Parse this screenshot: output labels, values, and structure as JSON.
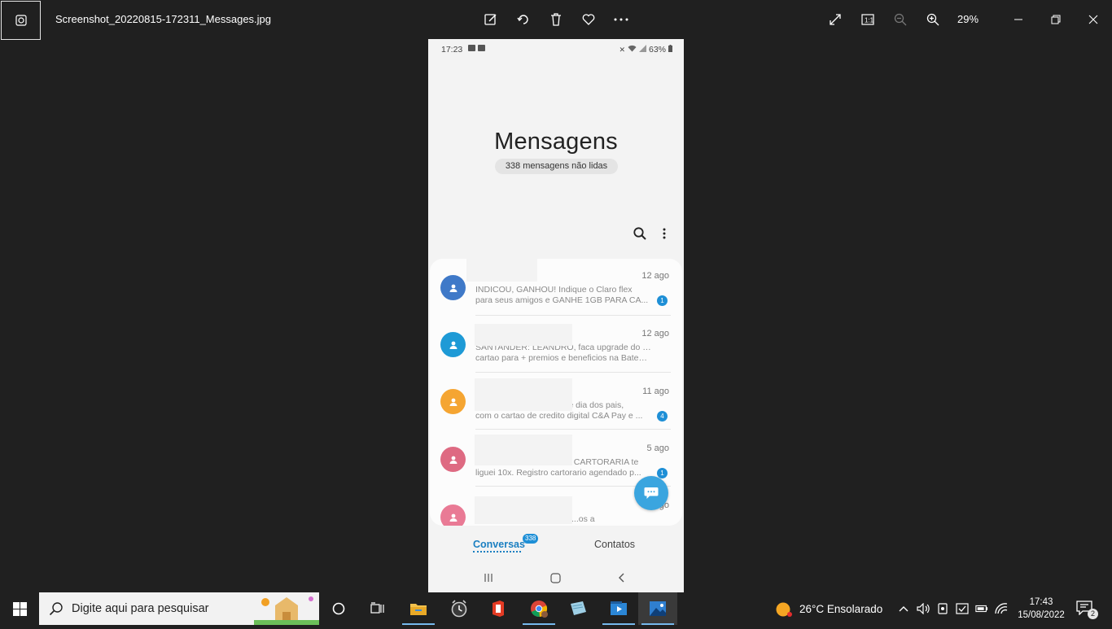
{
  "viewer": {
    "filename": "Screenshot_20220815-172311_Messages.jpg",
    "zoom": "29%",
    "toolbar_icons": [
      "edit-icon",
      "rotate-icon",
      "delete-icon",
      "favorite-icon",
      "more-icon"
    ],
    "right_icons": [
      "fullscreen-icon",
      "actual-size-icon",
      "zoom-out-icon",
      "zoom-in-icon"
    ],
    "window_controls": [
      "minimize-icon",
      "restore-icon",
      "close-icon"
    ]
  },
  "phone": {
    "status": {
      "time": "17:23",
      "battery": "63%"
    },
    "header": {
      "title": "Mensagens",
      "unread_label": "338 mensagens não lidas"
    },
    "conversations": [
      {
        "date": "12 ago",
        "line1": "INDICOU, GANHOU! Indique o Claro flex",
        "line2": "para seus amigos e GANHE 1GB PARA CA...",
        "unread": "1",
        "avatar_color": "#3f79c8"
      },
      {
        "date": "12 ago",
        "line1": "SANTANDER: LEANDRO, faca upgrade do seu",
        "line2": "cartao para + premios e beneficios na Bateu ...",
        "unread": "",
        "avatar_color": "#1e9ad6"
      },
      {
        "date": "11 ago",
        "line1": "Seu desconto especial de dia dos pais,",
        "line2": "com o cartao de credito digital C&A Pay e ...",
        "unread": "4",
        "avatar_color": "#f5a532"
      },
      {
        "date": "5 ago",
        "line1": "... O CARTORARIA te",
        "line2": "liguei 10x. Registro cartorario agendado p...",
        "unread": "1",
        "avatar_color": "#de6a82"
      },
      {
        "date": "ago",
        "line1": "...os a",
        "line2": "",
        "unread": "",
        "avatar_color": "#e97a95"
      }
    ],
    "tabs": {
      "conversations": "Conversas",
      "conversations_badge": "338",
      "contacts": "Contatos"
    }
  },
  "taskbar": {
    "search_placeholder": "Digite aqui para pesquisar",
    "weather": "26°C  Ensolarado",
    "time": "17:43",
    "date": "15/08/2022",
    "notifications": "2"
  }
}
